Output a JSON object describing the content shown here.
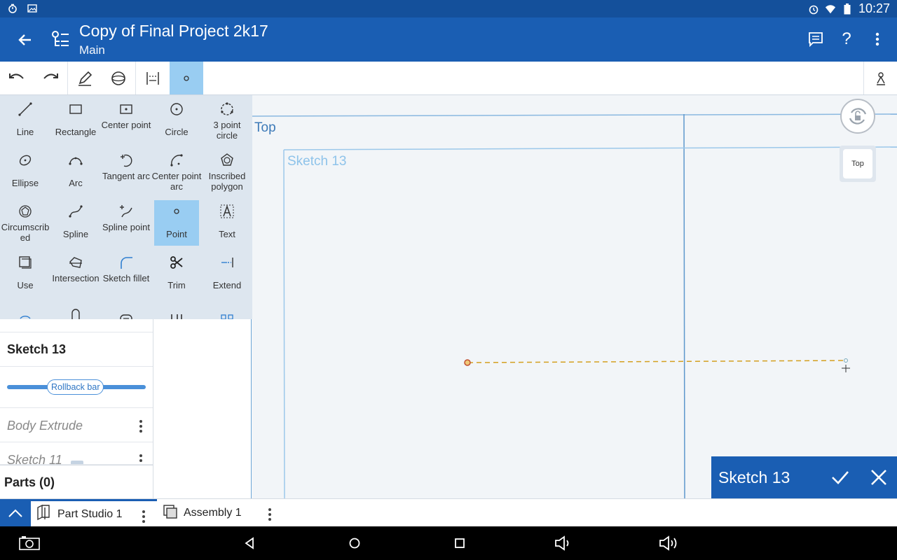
{
  "status_bar": {
    "time": "10:27",
    "left_icons": [
      "timer-icon",
      "image-icon"
    ],
    "right_icons": [
      "alarm-icon",
      "wifi-icon",
      "battery-icon"
    ]
  },
  "app_bar": {
    "title": "Copy of Final Project 2k17",
    "subtitle": "Main",
    "actions": [
      "comment-icon",
      "help-icon",
      "more-vert-icon"
    ]
  },
  "toolbar": {
    "buttons": [
      "undo-icon",
      "redo-icon",
      "sketch-pencil-icon",
      "sphere-icon",
      "constraint-icon",
      "point-icon"
    ],
    "active": "point-icon",
    "right_button": "appearance-icon"
  },
  "sketch_tools": [
    {
      "label": "Line",
      "icon": "line-tool-icon"
    },
    {
      "label": "Rectangle",
      "icon": "rectangle-tool-icon"
    },
    {
      "label": "Center point",
      "icon": "center-point-rect-icon"
    },
    {
      "label": "Circle",
      "icon": "circle-tool-icon"
    },
    {
      "label": "3 point circle",
      "icon": "three-point-circle-icon"
    },
    {
      "label": "Ellipse",
      "icon": "ellipse-tool-icon"
    },
    {
      "label": "Arc",
      "icon": "arc-tool-icon"
    },
    {
      "label": "Tangent arc",
      "icon": "tangent-arc-icon"
    },
    {
      "label": "Center point arc",
      "icon": "center-point-arc-icon"
    },
    {
      "label": "Inscribed polygon",
      "icon": "inscribed-polygon-icon"
    },
    {
      "label": "Circumscribed",
      "icon": "circumscribed-polygon-icon"
    },
    {
      "label": "Spline",
      "icon": "spline-tool-icon"
    },
    {
      "label": "Spline point",
      "icon": "spline-point-icon"
    },
    {
      "label": "Point",
      "icon": "point-tool-icon",
      "active": true
    },
    {
      "label": "Text",
      "icon": "text-tool-icon"
    },
    {
      "label": "Use",
      "icon": "use-tool-icon"
    },
    {
      "label": "Intersection",
      "icon": "intersection-tool-icon"
    },
    {
      "label": "Sketch fillet",
      "icon": "sketch-fillet-icon"
    },
    {
      "label": "Trim",
      "icon": "trim-tool-icon"
    },
    {
      "label": "Extend",
      "icon": "extend-tool-icon"
    }
  ],
  "feature_list": {
    "partial_label": "Sketch 1",
    "active_sketch": "Sketch 13",
    "rollback_label": "Rollback bar",
    "rolled_back": [
      "Body Extrude",
      "Sketch 11"
    ],
    "parts": "Parts (0)"
  },
  "canvas": {
    "plane_label": "Top",
    "sketch_label": "Sketch 13",
    "view_cube_face": "Top"
  },
  "sketch_dialog": {
    "name": "Sketch 13",
    "accept_icon": "check-icon",
    "cancel_icon": "close-icon"
  },
  "tabs": [
    {
      "label": "Part Studio 1",
      "icon": "part-studio-icon",
      "active": true
    },
    {
      "label": "Assembly 1",
      "icon": "assembly-icon",
      "active": false
    }
  ],
  "colors": {
    "primary": "#1a5eb3",
    "status_bar": "#14509b",
    "active_highlight": "#99cdf2",
    "panel_bg": "#dde6ef",
    "sketch_line": "#d4a020"
  }
}
